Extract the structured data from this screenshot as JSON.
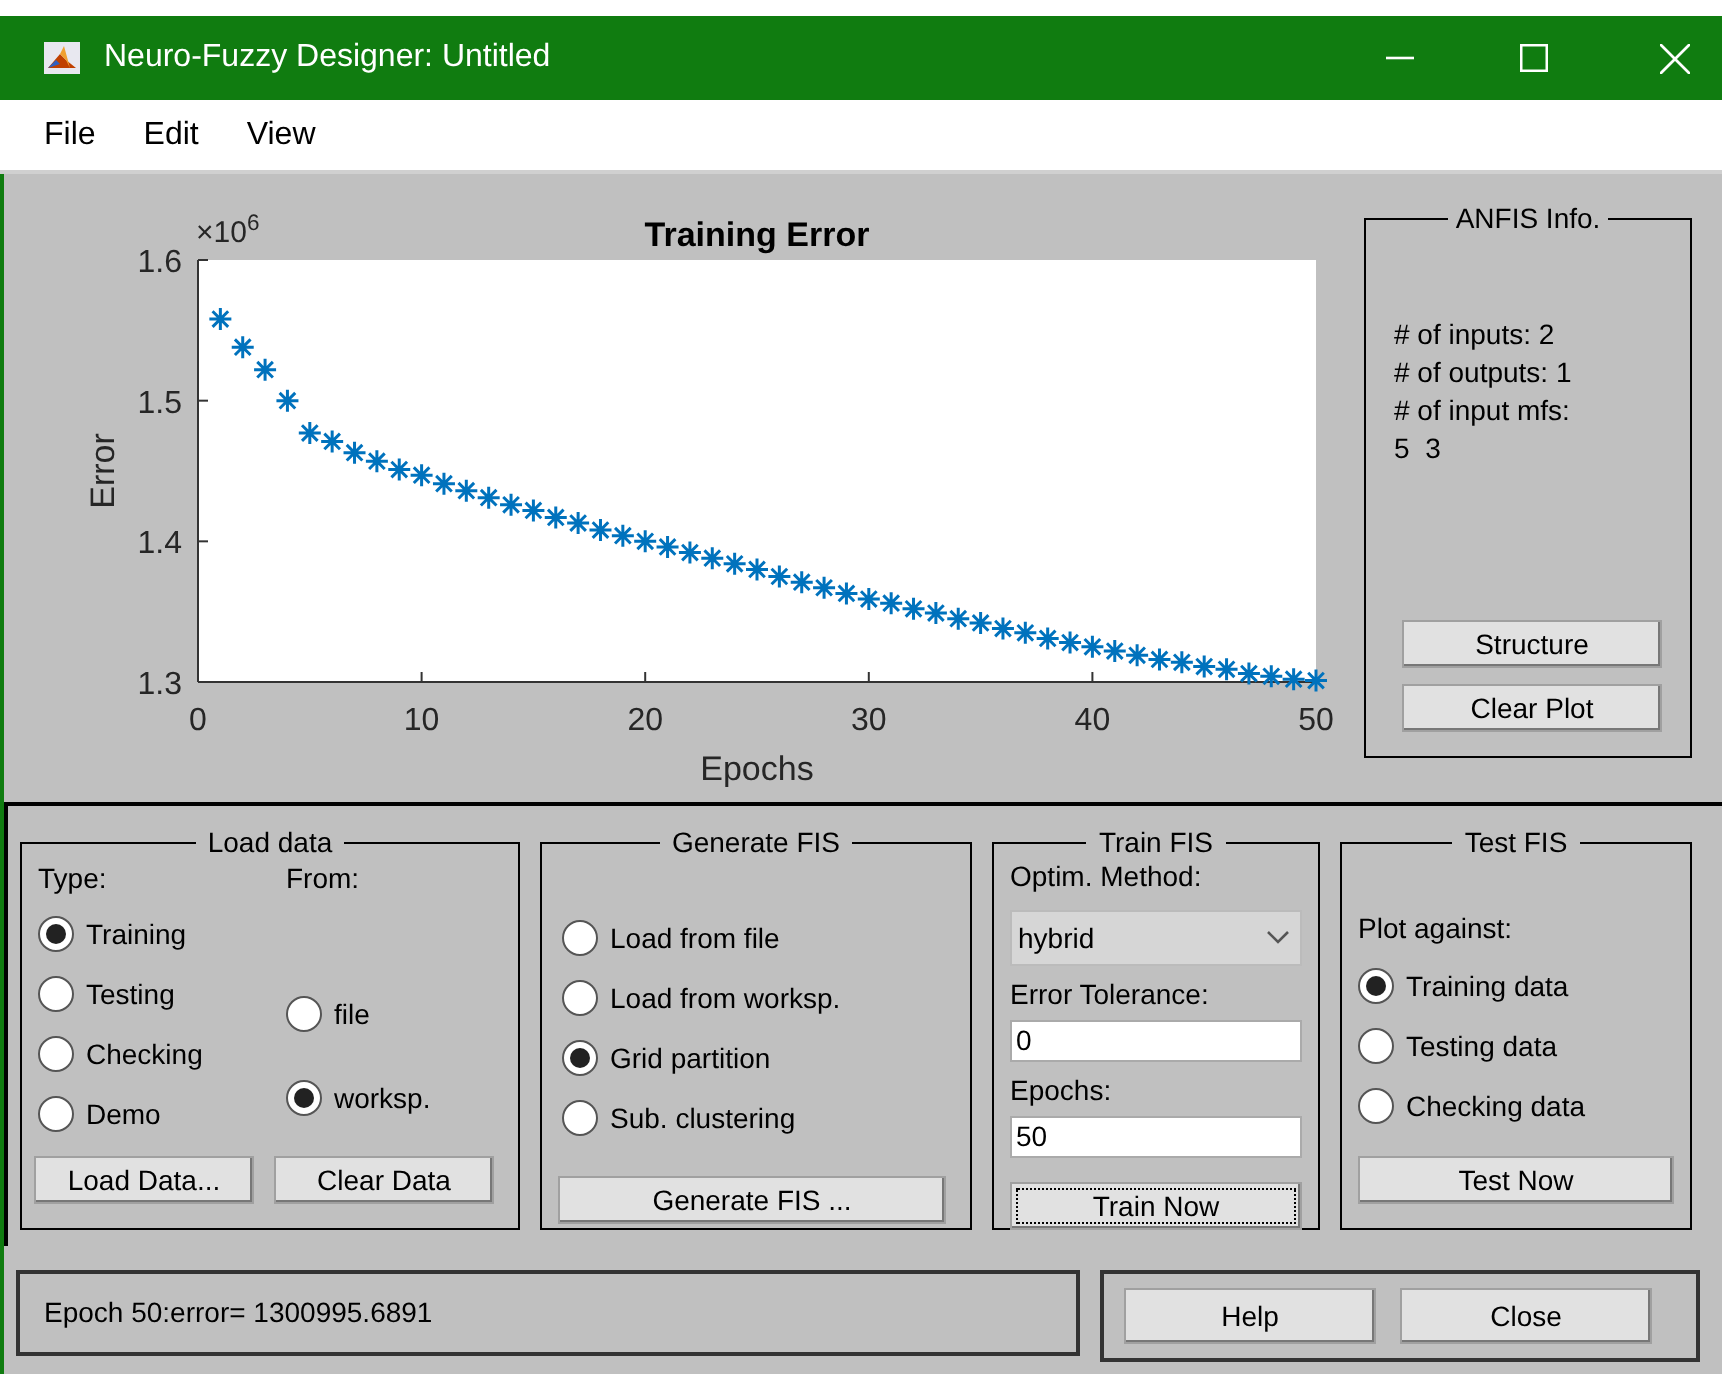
{
  "window": {
    "title": "Neuro-Fuzzy Designer: Untitled"
  },
  "menu": [
    "File",
    "Edit",
    "View"
  ],
  "plot": {
    "scale_label": "×10$^{6}$",
    "chart_data": {
      "type": "scatter",
      "title": "Training Error",
      "xlabel": "Epochs",
      "ylabel": "Error",
      "xlim": [
        0,
        50
      ],
      "ylim": [
        1.3,
        1.6
      ],
      "xticks": [
        0,
        10,
        20,
        30,
        40,
        50
      ],
      "yticks": [
        1.3,
        1.4,
        1.5,
        1.6
      ],
      "x": [
        1,
        2,
        3,
        4,
        5,
        6,
        7,
        8,
        9,
        10,
        11,
        12,
        13,
        14,
        15,
        16,
        17,
        18,
        19,
        20,
        21,
        22,
        23,
        24,
        25,
        26,
        27,
        28,
        29,
        30,
        31,
        32,
        33,
        34,
        35,
        36,
        37,
        38,
        39,
        40,
        41,
        42,
        43,
        44,
        45,
        46,
        47,
        48,
        49,
        50
      ],
      "series": [
        {
          "color": "#0072bd",
          "values": [
            1.558,
            1.538,
            1.522,
            1.5,
            1.477,
            1.471,
            1.463,
            1.457,
            1.451,
            1.447,
            1.441,
            1.436,
            1.431,
            1.426,
            1.422,
            1.417,
            1.413,
            1.408,
            1.404,
            1.4,
            1.396,
            1.392,
            1.388,
            1.384,
            1.38,
            1.375,
            1.371,
            1.367,
            1.363,
            1.359,
            1.356,
            1.352,
            1.349,
            1.345,
            1.342,
            1.338,
            1.335,
            1.331,
            1.328,
            1.325,
            1.322,
            1.319,
            1.316,
            1.314,
            1.311,
            1.309,
            1.306,
            1.304,
            1.302,
            1.301
          ]
        }
      ]
    }
  },
  "anfis_info": {
    "title": "ANFIS Info.",
    "lines": [
      "# of inputs: 2",
      "# of outputs: 1",
      "# of input mfs:",
      "5  3"
    ],
    "buttons": [
      "Structure",
      "Clear Plot"
    ]
  },
  "load_data": {
    "title": "Load data",
    "type_label": "Type:",
    "from_label": "From:",
    "types": [
      {
        "label": "Training",
        "selected": true
      },
      {
        "label": "Testing",
        "selected": false
      },
      {
        "label": "Checking",
        "selected": false
      },
      {
        "label": "Demo",
        "selected": false
      }
    ],
    "sources": [
      {
        "label": "file",
        "selected": false
      },
      {
        "label": "worksp.",
        "selected": true
      }
    ],
    "buttons": [
      "Load Data...",
      "Clear Data"
    ]
  },
  "generate_fis": {
    "title": "Generate FIS",
    "options": [
      {
        "label": "Load from file",
        "selected": false
      },
      {
        "label": "Load from worksp.",
        "selected": false
      },
      {
        "label": "Grid partition",
        "selected": true
      },
      {
        "label": "Sub. clustering",
        "selected": false
      }
    ],
    "button": "Generate FIS ..."
  },
  "train_fis": {
    "title": "Train FIS",
    "method_label": "Optim. Method:",
    "method": "hybrid",
    "tolerance_label": "Error Tolerance:",
    "tolerance": "0",
    "epochs_label": "Epochs:",
    "epochs": "50",
    "button": "Train Now"
  },
  "test_fis": {
    "title": "Test FIS",
    "plot_label": "Plot against:",
    "options": [
      {
        "label": "Training data",
        "selected": true
      },
      {
        "label": "Testing data",
        "selected": false
      },
      {
        "label": "Checking data",
        "selected": false
      }
    ],
    "button": "Test Now"
  },
  "status": "Epoch 50:error= 1300995.6891",
  "buttons": [
    "Help",
    "Close"
  ]
}
